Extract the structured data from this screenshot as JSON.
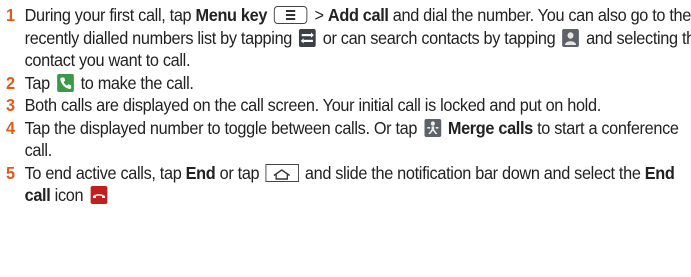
{
  "steps": [
    {
      "number": "1",
      "t1": "During your first call, tap ",
      "menu_key": "Menu key",
      "t2": " > ",
      "add_call": "Add call",
      "t3": " and dial the number. You can also go to the recently dialled numbers list by tapping ",
      "t4": " or can search contacts by tapping ",
      "t5": " and selecting the contact you want to call."
    },
    {
      "number": "2",
      "t1": "Tap ",
      "t2": " to make the call."
    },
    {
      "number": "3",
      "t1": "Both calls are displayed on the call screen. Your initial call is locked and put on hold."
    },
    {
      "number": "4",
      "t1": "Tap the displayed number to toggle between calls. Or tap ",
      "merge_calls": "Merge calls",
      "t2": " to start a conference call."
    },
    {
      "number": "5",
      "t1": "To end active calls, tap ",
      "end": "End",
      "t2": " or tap ",
      "t3": " and slide the notification bar down and select the ",
      "end_call": "End call",
      "t4": " icon "
    }
  ],
  "icons": {
    "menu_key": "menu-key-icon",
    "recent_calls": "call-log-icon",
    "contacts": "contacts-icon",
    "call": "call-icon",
    "merge": "merge-calls-icon",
    "home_key": "home-key-icon",
    "end_call": "end-call-icon"
  },
  "colors": {
    "step_number": "#e05a1a",
    "text": "#222222",
    "call_green": "#3b9a46",
    "end_call_red": "#c21f1f"
  }
}
